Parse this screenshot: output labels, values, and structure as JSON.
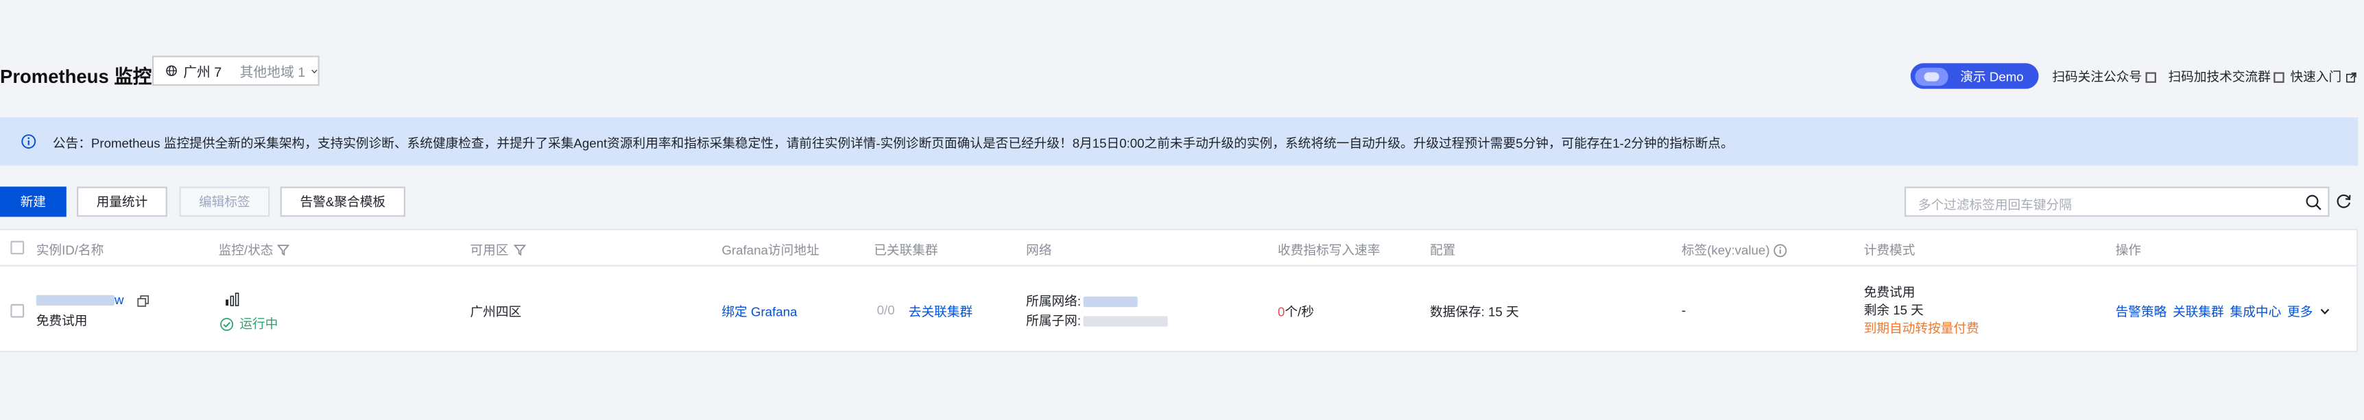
{
  "header": {
    "title": "Prometheus 监控",
    "region": "广州 7",
    "other_regions": "其他地域 1",
    "demo_label": "演示 Demo",
    "follow_label": "扫码关注公众号",
    "group_label": "扫码加技术交流群",
    "quick_entry_label": "快速入门"
  },
  "notice": {
    "text": "公告：Prometheus 监控提供全新的采集架构，支持实例诊断、系统健康检查，并提升了采集Agent资源利用率和指标采集稳定性，请前往实例详情-实例诊断页面确认是否已经升级！8月15日0:00之前未手动升级的实例，系统将统一自动升级。升级过程预计需要5分钟，可能存在1-2分钟的指标断点。"
  },
  "toolbar": {
    "new_label": "新建",
    "usage_label": "用量统计",
    "edit_tags_label": "编辑标签",
    "alert_label": "告警&聚合模板",
    "search_placeholder": "多个过滤标签用回车键分隔"
  },
  "table": {
    "columns": {
      "id": "实例ID/名称",
      "status": "监控/状态",
      "zone": "可用区",
      "grafana": "Grafana访问地址",
      "clusters": "已关联集群",
      "network": "网络",
      "rate": "收费指标写入速率",
      "config": "配置",
      "tags": "标签(key:value)",
      "billing": "计费模式",
      "actions": "操作"
    },
    "row": {
      "id_suffix": "w",
      "name": "免费试用",
      "status": "运行中",
      "zone": "广州四区",
      "grafana_link": "绑定 Grafana",
      "cluster_count": "0/0",
      "associate_link": "去关联集群",
      "network_label": "所属网络:",
      "subnet_label": "所属子网:",
      "rate_value": "0",
      "rate_unit": "个/秒",
      "config": "数据保存: 15 天",
      "tags": "-",
      "billing_mode": "免费试用",
      "billing_remaining": "剩余 15 天",
      "billing_note": "到期自动转按量付费",
      "action_alert": "告警策略",
      "action_cluster": "关联集群",
      "action_integration": "集成中心",
      "action_more": "更多"
    }
  }
}
